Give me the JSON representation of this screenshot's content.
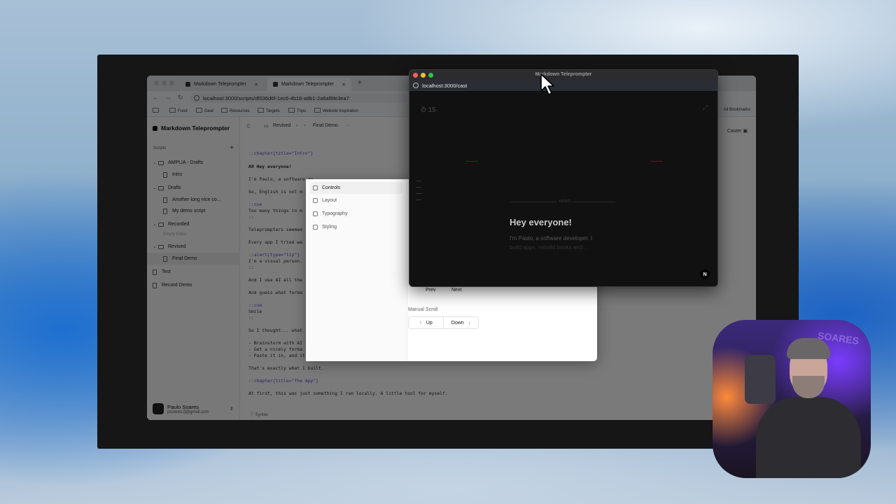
{
  "browser": {
    "tabs": [
      {
        "label": "Markdown Teleprompter",
        "active": false
      },
      {
        "label": "Markdown Teleprompter",
        "active": true
      }
    ],
    "add_tab": "+",
    "close": "✕",
    "url": "localhost:3000/scripts/df036d6f-1ec6-4b16-a9b1-2a6af6fe3ea7",
    "bookmarks": [
      "Food",
      "Gear",
      "Resources",
      "Targets",
      "Trips",
      "Website Inspiration"
    ],
    "bookmarks_extra": "All Bookmarks"
  },
  "sidebar": {
    "app_title": "Markdown Teleprompter",
    "section_label": "Scripts",
    "add": "+",
    "tree": [
      {
        "kind": "folder",
        "label": "AMPLIA - Drafts",
        "level": 0
      },
      {
        "kind": "doc",
        "label": "Intro",
        "level": 1
      },
      {
        "kind": "folder",
        "label": "Drafts",
        "level": 0
      },
      {
        "kind": "doc",
        "label": "Another long nice co...",
        "level": 1
      },
      {
        "kind": "doc",
        "label": "My demo script",
        "level": 1
      },
      {
        "kind": "folder",
        "label": "Recorded",
        "level": 0
      },
      {
        "kind": "empty",
        "label": "Empty folder",
        "level": 1
      },
      {
        "kind": "folder",
        "label": "Revised",
        "level": 0
      },
      {
        "kind": "doc",
        "label": "Final Demo",
        "level": 1,
        "selected": true
      },
      {
        "kind": "doc",
        "label": "Test",
        "level": 0
      },
      {
        "kind": "doc",
        "label": "Record Demo",
        "level": 0
      }
    ],
    "user": {
      "name": "Paulo Soares",
      "email": "psoares.fj@gmail.com"
    }
  },
  "editor": {
    "breadcrumb": [
      "Revised",
      "Final Demo"
    ],
    "more": "···",
    "caster": "Caster",
    "syntax": "Syntax",
    "lines": [
      {
        "t": "::chapter{title=\"Intro\"}",
        "cls": "dir"
      },
      {
        "t": "## Hey everyone!",
        "cls": "bold"
      },
      {
        "t": "I'm Paulo, a software de",
        "cls": ""
      },
      {
        "t": "So, English is not m",
        "cls": ""
      },
      {
        "t": "::cue",
        "cls": "dir"
      },
      {
        "t": "Too many things in m",
        "cls": ""
      },
      {
        "t": "::",
        "cls": ""
      },
      {
        "t": "Teleprompters seemed",
        "cls": ""
      },
      {
        "t": "Every app I tried wa",
        "cls": ""
      },
      {
        "t": "::alert{type=\"tip\"}",
        "cls": "dir"
      },
      {
        "t": "I'm a visual person.",
        "cls": ""
      },
      {
        "t": "::",
        "cls": ""
      },
      {
        "t": "And I use AI all the",
        "cls": ""
      },
      {
        "t": "And guess what forma",
        "cls": ""
      },
      {
        "t": "::cue",
        "cls": "dir"
      },
      {
        "t": "Smile",
        "cls": ""
      },
      {
        "t": "::",
        "cls": ""
      },
      {
        "t": "So I thought... what",
        "cls": ""
      },
      {
        "t": "- Brainstorm with AI",
        "cls": ""
      },
      {
        "t": "- Get a nicely forma",
        "cls": ""
      },
      {
        "t": "- Paste it in, and it just works",
        "cls": ""
      },
      {
        "t": "That's exactly what I built.",
        "cls": ""
      },
      {
        "t": "::chapter{title=\"The App\"}",
        "cls": "dir"
      },
      {
        "t": "At first, this was just something I ran locally. A little tool for myself.",
        "cls": ""
      }
    ]
  },
  "controls": {
    "nav": [
      {
        "label": "Controls",
        "icon": "controls-icon",
        "active": true
      },
      {
        "label": "Layout",
        "icon": "layout-icon",
        "active": false
      },
      {
        "label": "Typography",
        "icon": "typography-icon",
        "active": false
      },
      {
        "label": "Styling",
        "icon": "styling-icon",
        "active": false
      }
    ],
    "prev": "Prev",
    "next": "Next",
    "manual_scroll": "Manual Scroll",
    "up": "Up",
    "down": "Down"
  },
  "teleprompter": {
    "window_title": "Markdown Teleprompter",
    "url": "localhost:3000/cast",
    "timer": "15",
    "chapter_label": "INTRO",
    "heading": "Hey everyone!",
    "lines": [
      "I'm Paulo, a software developer. I",
      "build apps, rebuild books and..."
    ],
    "badge": "N"
  },
  "colors": {
    "accent": "#5b4bd1",
    "tp_close": "#ff5f57",
    "tp_min": "#febc2e",
    "tp_max": "#28c840"
  },
  "webcam": {
    "sign": "SOARES"
  }
}
